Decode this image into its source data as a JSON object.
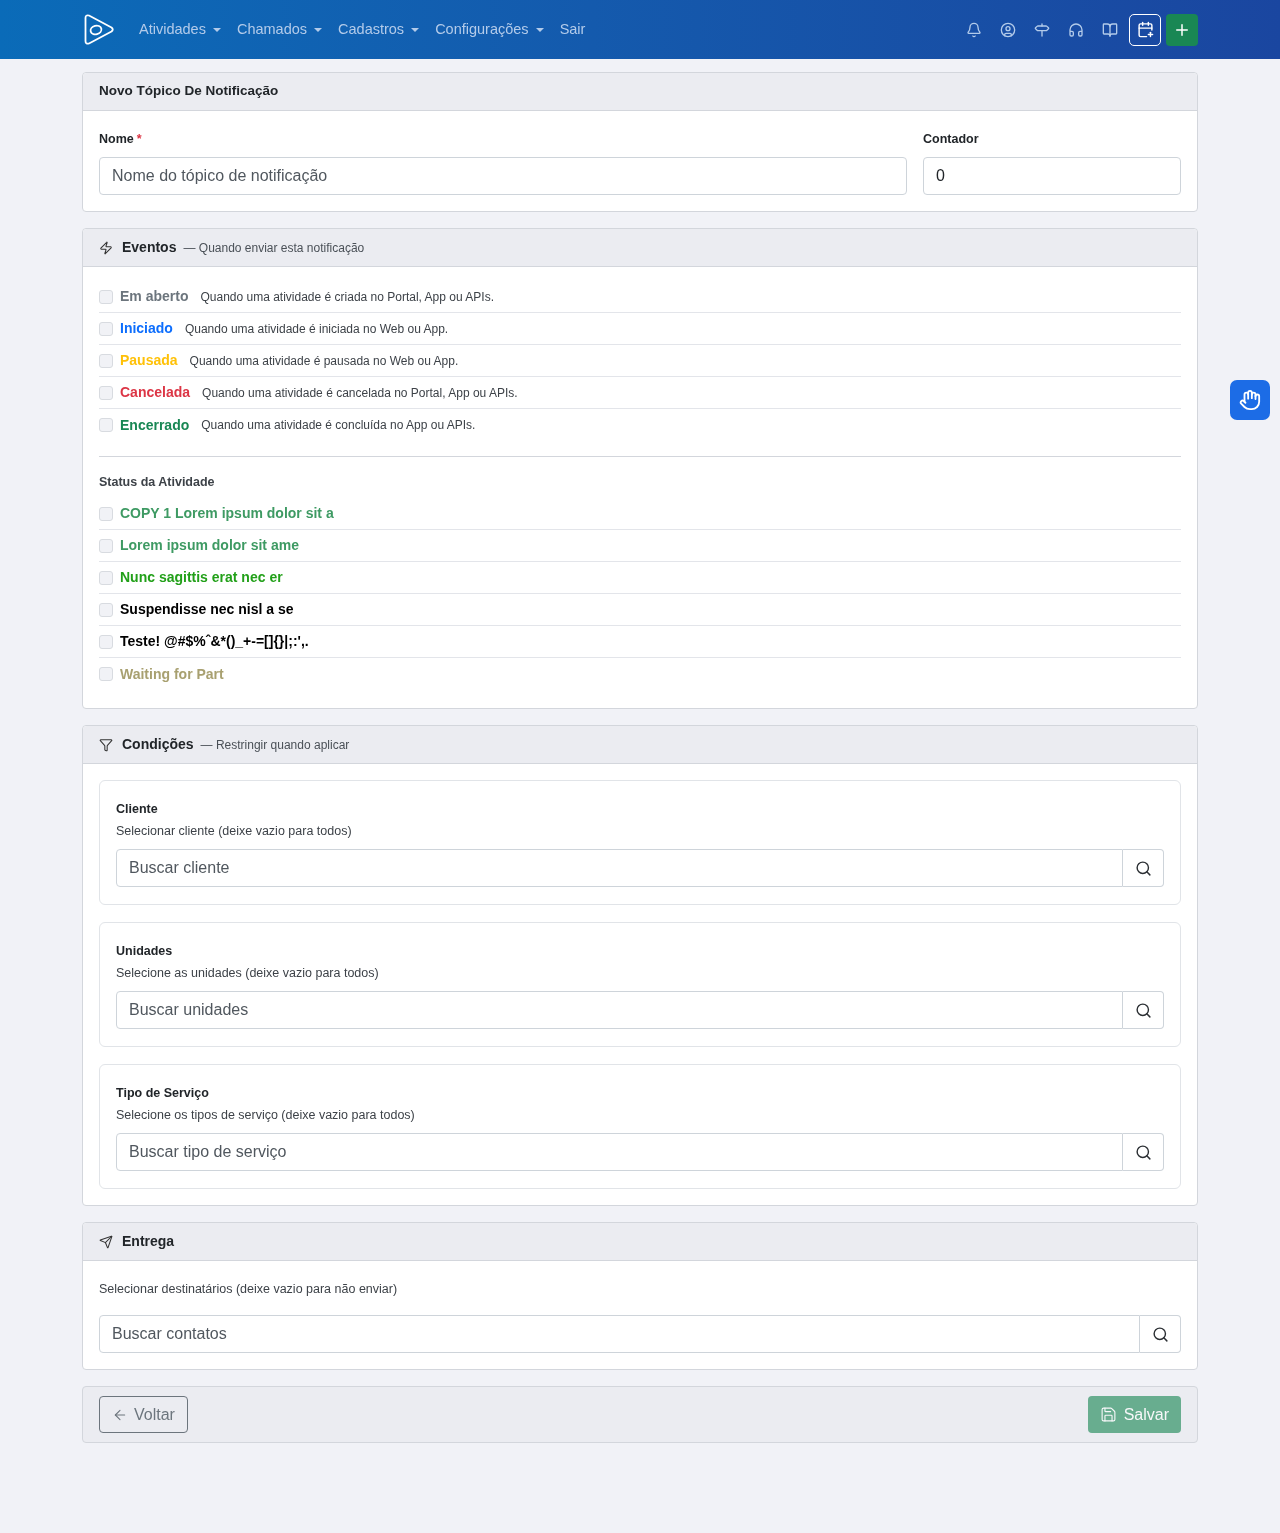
{
  "navbar": {
    "menu": [
      {
        "label": "Atividades",
        "dropdown": true
      },
      {
        "label": "Chamados",
        "dropdown": true
      },
      {
        "label": "Cadastros",
        "dropdown": true
      },
      {
        "label": "Configurações",
        "dropdown": true
      },
      {
        "label": "Sair",
        "dropdown": false
      }
    ]
  },
  "topic": {
    "title": "Novo Tópico De Notificação",
    "fields": [
      {
        "label": "Nome",
        "required_mark": "*",
        "placeholder": "Nome do tópico de notificação"
      },
      {
        "label": "Contador",
        "value": "0"
      }
    ]
  },
  "events": {
    "title": "Eventos",
    "subtitle": "— Quando enviar esta notificação",
    "items": [
      {
        "label": "Em aberto",
        "description": "Quando uma atividade é criada no Portal, App ou APIs.",
        "color": "#6c757d",
        "checked": false
      },
      {
        "label": "Iniciado",
        "description": "Quando uma atividade é iniciada no Web ou App.",
        "color": "#0d6efd",
        "checked": false
      },
      {
        "label": "Pausada",
        "description": "Quando uma atividade é pausada no Web ou App.",
        "color": "#ffc107",
        "checked": false
      },
      {
        "label": "Cancelada",
        "description": "Quando uma atividade é cancelada no Portal, App ou APIs.",
        "color": "#dc3545",
        "checked": false
      },
      {
        "label": "Encerrado",
        "description": "Quando uma atividade é concluída no App ou APIs.",
        "color": "#198754",
        "checked": false
      }
    ],
    "status_title": "Status da Atividade",
    "statuses": [
      {
        "label": "COPY 1 Lorem ipsum dolor sit a",
        "color": "#3e9a63",
        "checked": false
      },
      {
        "label": "Lorem ipsum dolor sit ame",
        "color": "#3e9a63",
        "checked": false
      },
      {
        "label": "Nunc sagittis erat nec er",
        "color": "#22a019",
        "checked": false
      },
      {
        "label": "Suspendisse nec nisl a se",
        "color": "#000000",
        "checked": false
      },
      {
        "label": "Teste! @#$%ˆ&*()_+-=[]{}|;:',.",
        "color": "#000000",
        "checked": false
      },
      {
        "label": "Waiting for Part",
        "color": "#a8a070",
        "checked": false
      }
    ]
  },
  "conditions": {
    "title": "Condições",
    "subtitle": "— Restringir quando aplicar",
    "groups": [
      {
        "label": "Cliente",
        "hint": "Selecionar cliente (deixe vazio para todos)",
        "placeholder": "Buscar cliente"
      },
      {
        "label": "Unidades",
        "hint": "Selecione as unidades (deixe vazio para todos)",
        "placeholder": "Buscar unidades"
      },
      {
        "label": "Tipo de Serviço",
        "hint": "Selecione os tipos de serviço (deixe vazio para todos)",
        "placeholder": "Buscar tipo de serviço"
      }
    ]
  },
  "delivery": {
    "title": "Entrega",
    "hint": "Selecionar destinatários (deixe vazio para não enviar)",
    "placeholder": "Buscar contatos"
  },
  "footer": {
    "back": {
      "label": "Voltar"
    },
    "save": {
      "label": "Salvar",
      "disabled": true
    }
  }
}
